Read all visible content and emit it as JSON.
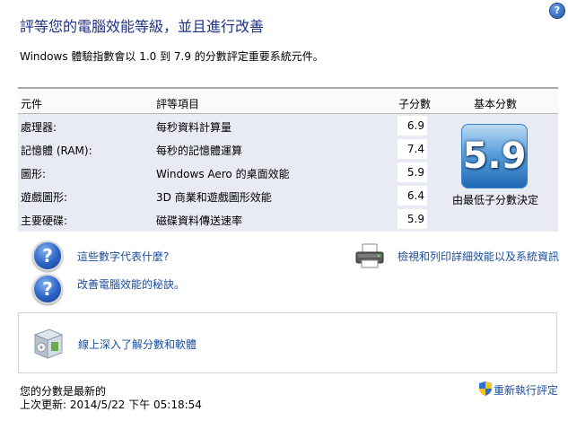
{
  "help_icon_glyph": "?",
  "title": "評等您的電腦效能等級，並且進行改善",
  "intro": "Windows 體驗指數會以 1.0 到 7.9 的分數評定重要系統元件。",
  "table": {
    "headers": {
      "component": "元件",
      "rated": "評等項目",
      "subscore": "子分數",
      "base": "基本分數"
    },
    "rows": [
      {
        "component": "處理器:",
        "item": "每秒資料計算量",
        "score": "6.9"
      },
      {
        "component": "記憶體 (RAM):",
        "item": "每秒的記憶體運算",
        "score": "7.4"
      },
      {
        "component": "圖形:",
        "item": "Windows Aero 的桌面效能",
        "score": "5.9"
      },
      {
        "component": "遊戲圖形:",
        "item": "3D 商業和遊戲圖形效能",
        "score": "6.4"
      },
      {
        "component": "主要硬碟:",
        "item": "磁碟資料傳送速率",
        "score": "5.9"
      }
    ],
    "base_score": "5.9",
    "base_caption": "由最低子分數決定"
  },
  "links": {
    "what_mean": "這些數字代表什麼?",
    "tips": "改善電腦效能的秘訣。",
    "print": "檢視和列印詳細效能以及系統資訊",
    "online": "線上深入了解分數和軟體"
  },
  "question_glyph": "?",
  "status": {
    "current": "您的分數是最新的",
    "last_update": "上次更新: 2014/5/22 下午 05:18:54"
  },
  "rerun": "重新執行評定"
}
